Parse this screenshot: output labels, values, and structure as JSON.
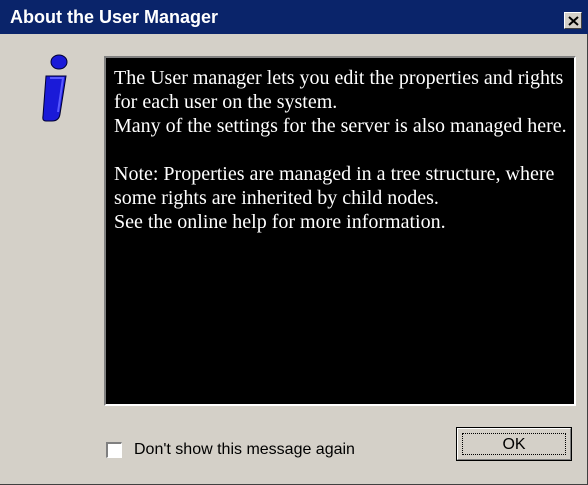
{
  "window": {
    "title": "About the User Manager",
    "close_icon": "close-icon",
    "colors": {
      "titlebar": "#0a246a",
      "face": "#d4d0c8",
      "message_bg": "#000000",
      "message_text": "#ffffff",
      "icon": "#1a1ad8"
    }
  },
  "icon": {
    "name": "info-icon"
  },
  "message": {
    "line1": "The User manager lets you edit the properties and rights for each user on the system.",
    "line2": "Many of the settings for the server is also managed here.",
    "line3": "Note: Properties are managed in a tree structure, where some rights are inherited by child nodes.",
    "line4": "See the online help for more information."
  },
  "footer": {
    "checkbox_label": "Don't show this message again",
    "checkbox_checked": false,
    "ok_label": "OK"
  }
}
